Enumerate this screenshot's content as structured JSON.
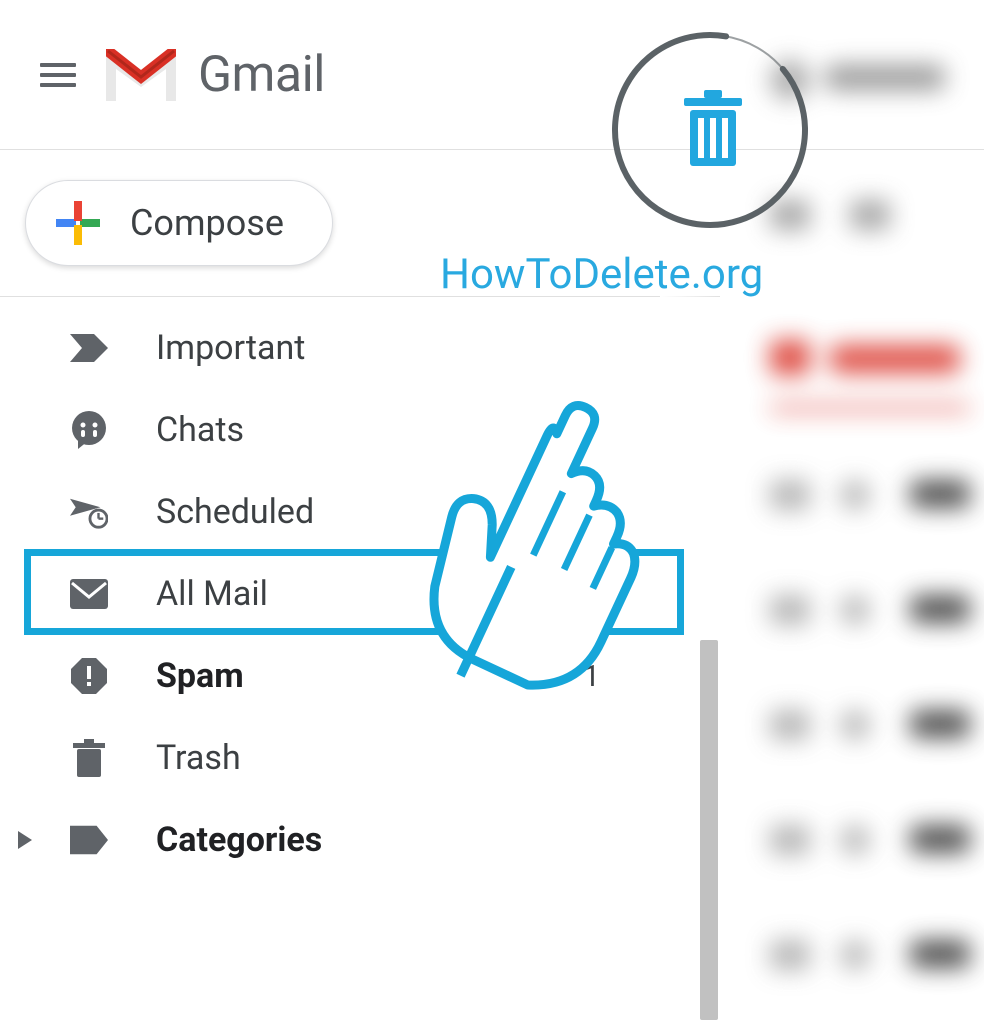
{
  "header": {
    "app_name": "Gmail"
  },
  "compose": {
    "label": "Compose"
  },
  "watermark": {
    "text": "HowToDelete.org"
  },
  "sidebar": {
    "items": [
      {
        "icon": "important",
        "label": "Important",
        "bold": false
      },
      {
        "icon": "chats",
        "label": "Chats",
        "bold": false
      },
      {
        "icon": "scheduled",
        "label": "Scheduled",
        "bold": false
      },
      {
        "icon": "allmail",
        "label": "All Mail",
        "bold": false,
        "highlighted": true
      },
      {
        "icon": "spam",
        "label": "Spam",
        "bold": true,
        "count": "1"
      },
      {
        "icon": "trash",
        "label": "Trash",
        "bold": false
      },
      {
        "icon": "categories",
        "label": "Categories",
        "bold": true,
        "caret": true
      }
    ]
  }
}
